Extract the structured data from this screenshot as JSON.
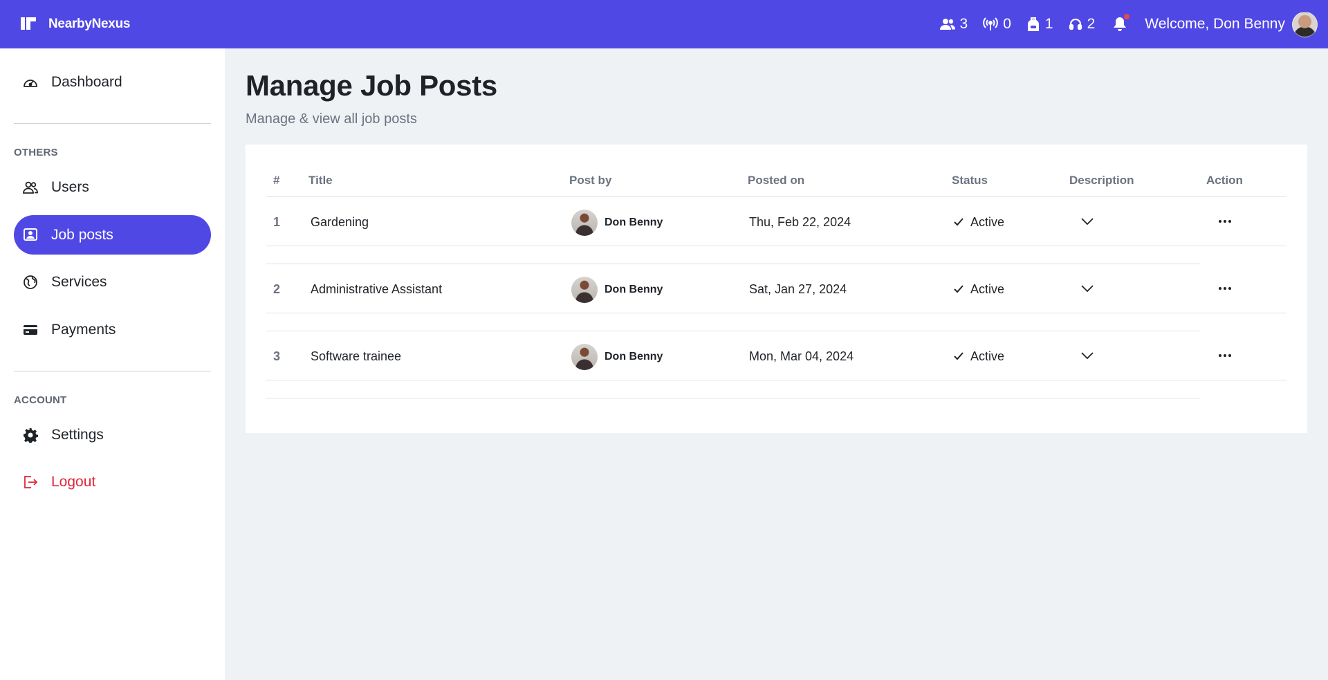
{
  "brand": {
    "name": "NearbyNexus"
  },
  "topbar": {
    "stats": [
      {
        "icon": "users-icon",
        "value": "3"
      },
      {
        "icon": "broadcast-icon",
        "value": "0"
      },
      {
        "icon": "backpack-icon",
        "value": "1"
      },
      {
        "icon": "headset-icon",
        "value": "2"
      }
    ],
    "welcome": "Welcome, Don Benny"
  },
  "sidebar": {
    "dashboard": "Dashboard",
    "others_heading": "OTHERS",
    "users": "Users",
    "job_posts": "Job posts",
    "services": "Services",
    "payments": "Payments",
    "account_heading": "ACCOUNT",
    "settings": "Settings",
    "logout": "Logout"
  },
  "page": {
    "title": "Manage Job Posts",
    "subtitle": "Manage & view all job posts"
  },
  "table": {
    "headers": [
      "#",
      "Title",
      "Post by",
      "Posted on",
      "Status",
      "Description",
      "Action"
    ],
    "rows": [
      {
        "num": "1",
        "title": "Gardening",
        "post_by": "Don Benny",
        "posted_on": "Thu, Feb 22, 2024",
        "status": "Active"
      },
      {
        "num": "2",
        "title": "Administrative Assistant",
        "post_by": "Don Benny",
        "posted_on": "Sat, Jan 27, 2024",
        "status": "Active"
      },
      {
        "num": "3",
        "title": "Software trainee",
        "post_by": "Don Benny",
        "posted_on": "Mon, Mar 04, 2024",
        "status": "Active"
      }
    ]
  },
  "colors": {
    "accent": "#5048e5",
    "logout": "#e0263b",
    "notification_dot": "#e5484d"
  }
}
